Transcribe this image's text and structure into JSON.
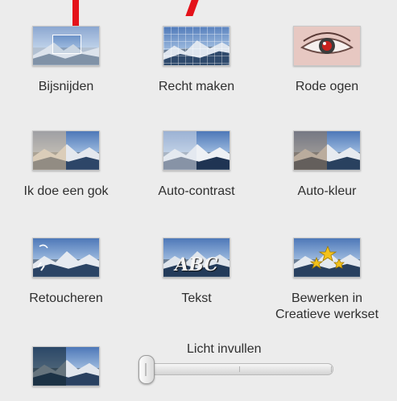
{
  "tools": [
    {
      "label": "Bijsnijden",
      "icon": "crop-icon"
    },
    {
      "label": "Recht maken",
      "icon": "straighten-icon"
    },
    {
      "label": "Rode ogen",
      "icon": "red-eye-icon"
    },
    {
      "label": "Ik doe een gok",
      "icon": "auto-fix-icon"
    },
    {
      "label": "Auto-contrast",
      "icon": "auto-contrast-icon"
    },
    {
      "label": "Auto-kleur",
      "icon": "auto-color-icon"
    },
    {
      "label": "Retoucheren",
      "icon": "retouch-icon"
    },
    {
      "label": "Tekst",
      "icon": "text-icon",
      "thumb_text": "ABC"
    },
    {
      "label_line1": "Bewerken in",
      "label_line2": "Creatieve werkset",
      "icon": "creative-kit-icon"
    }
  ],
  "fill_light": {
    "label": "Licht invullen",
    "value": 0.0,
    "icon": "fill-light-icon"
  },
  "colors": {
    "background": "#ececec",
    "annotation": "#e4121a"
  }
}
